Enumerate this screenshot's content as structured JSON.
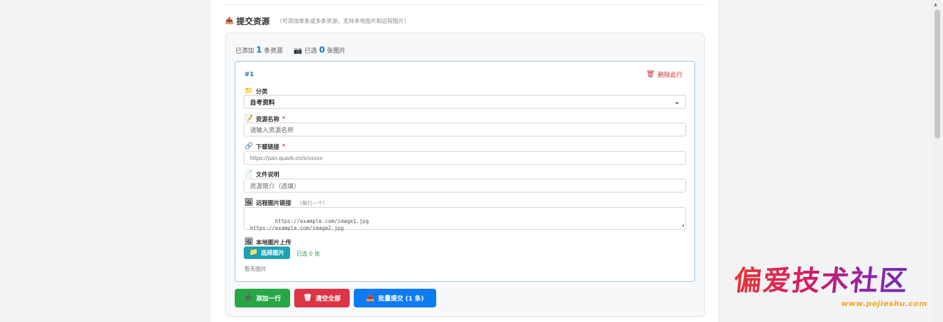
{
  "section": {
    "icon": "upload-tray-icon",
    "title": "提交资源",
    "hint": "（可添加单条或多条资源，支持本地图片和远程图片）"
  },
  "stats": {
    "added_prefix": "已添加",
    "added_count": "1",
    "added_suffix": "条资源",
    "image_icon": "camera-icon",
    "selected_prefix": "已选",
    "selected_count": "0",
    "selected_suffix": "张图片"
  },
  "row": {
    "number": "#1",
    "delete_label": "删除此行",
    "category": {
      "label": "分类",
      "value": "自考资料"
    },
    "name": {
      "label": "资源名称",
      "required": "*",
      "placeholder": "请输入资源名称"
    },
    "link": {
      "label": "下载链接",
      "required": "*",
      "placeholder": "https://pan.quark.cn/s/xxxxx"
    },
    "desc": {
      "label": "文件说明",
      "placeholder": "资源简介（选填）"
    },
    "remote": {
      "label": "远程图片链接",
      "hint": "（每行一个）",
      "placeholder": "https://example.com/image1.jpg\nhttps://example.com/image2.jpg"
    },
    "local": {
      "label": "本地图片上传",
      "button": "选择图片",
      "picked": "已选 0 张",
      "empty": "暂无图片"
    }
  },
  "actions": {
    "add": "添加一行",
    "clear": "清空全部",
    "submit": "批量提交 (1 条)"
  },
  "watermark": {
    "title": "偏爱技术社区",
    "url": "www.pojieshu.com"
  },
  "colors": {
    "accent": "#1976d2",
    "add": "#28a745",
    "clear": "#dc3545",
    "submit": "#0d7bf2",
    "picker": "#1da1b3"
  }
}
